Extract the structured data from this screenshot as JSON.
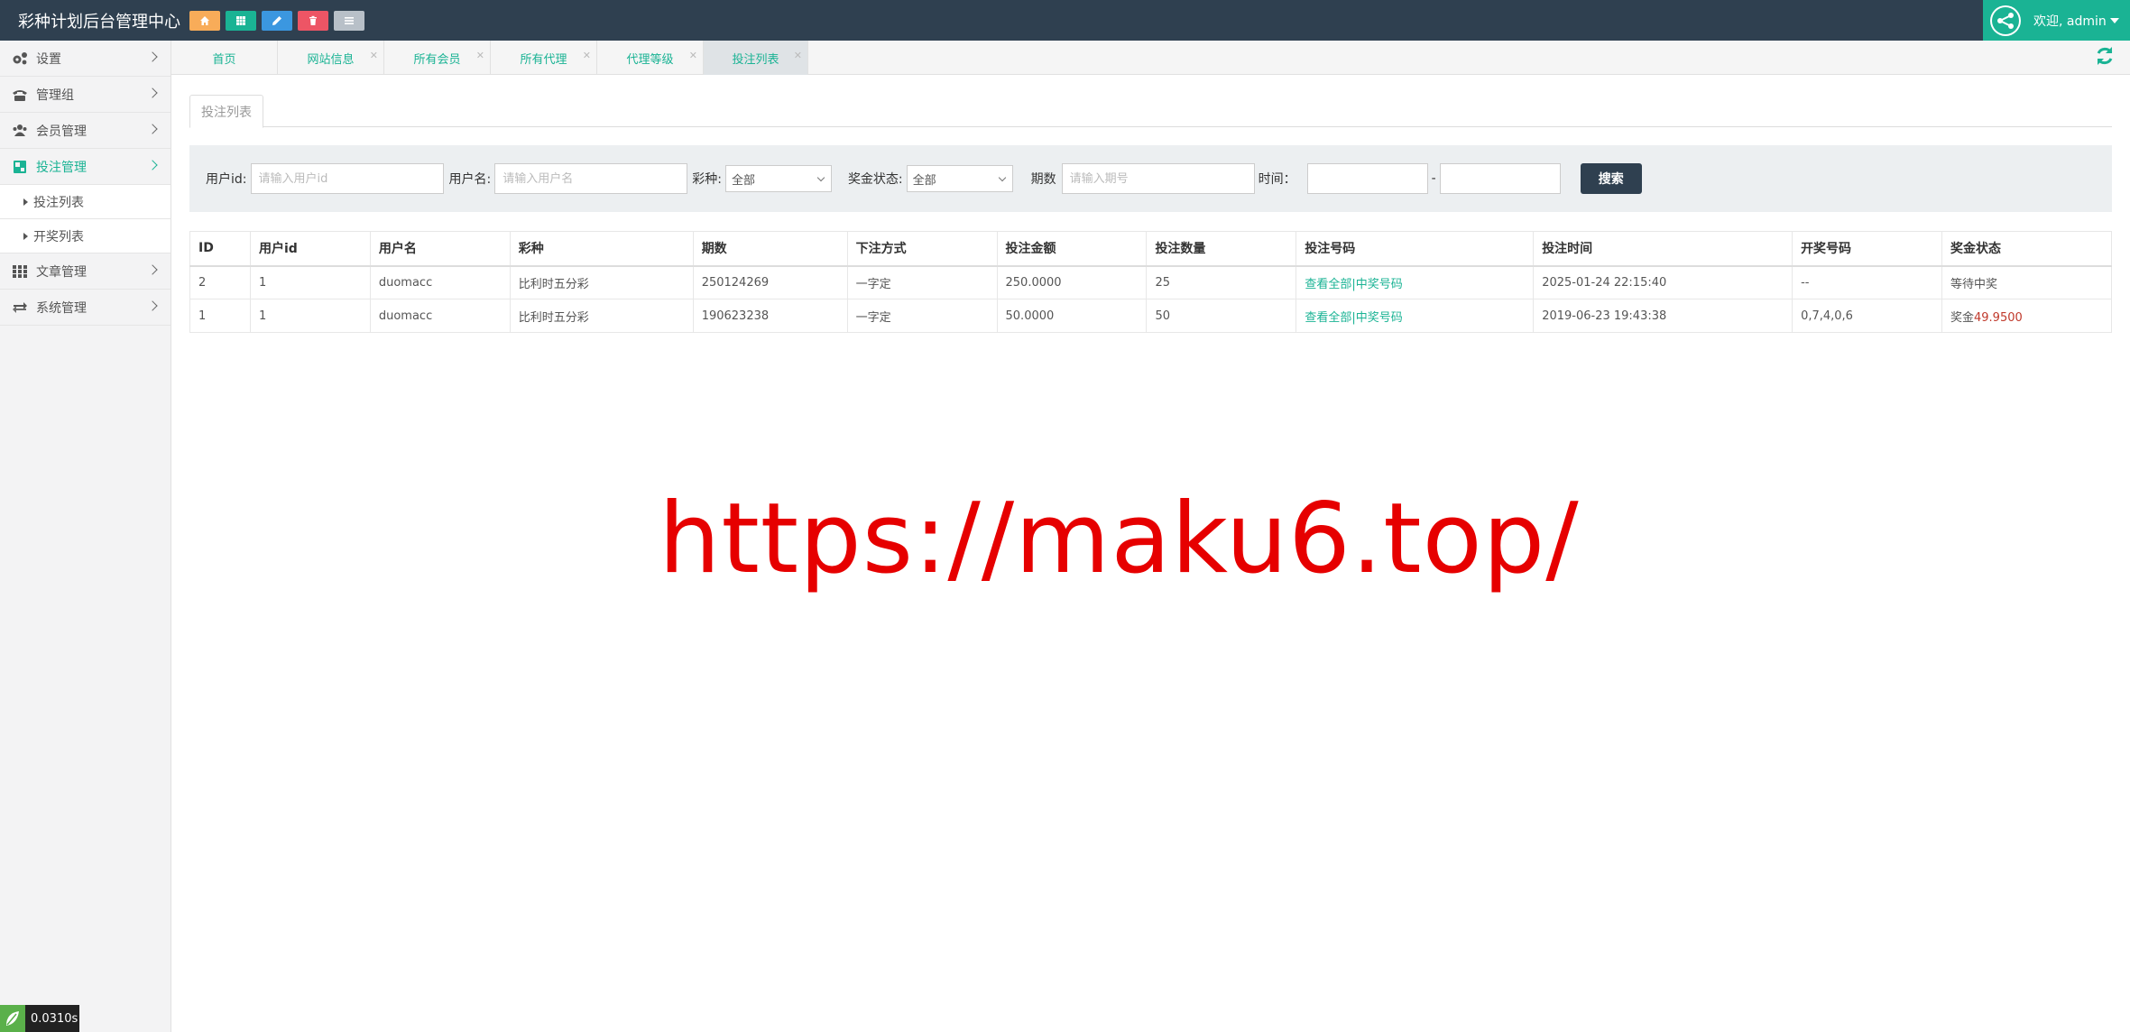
{
  "app": {
    "title": "彩种计划后台管理中心"
  },
  "quick_buttons": [
    {
      "icon": "home-icon",
      "color": "#f8ac59"
    },
    {
      "icon": "grid-icon",
      "color": "#1ab394"
    },
    {
      "icon": "pencil-icon",
      "color": "#3b97e0"
    },
    {
      "icon": "trash-icon",
      "color": "#ed5565"
    },
    {
      "icon": "list-icon",
      "color": "#b8c0c8"
    }
  ],
  "user": {
    "welcome": "欢迎, admin"
  },
  "sidebar": {
    "items": [
      {
        "label": "设置",
        "icon": "gears-icon"
      },
      {
        "label": "管理组",
        "icon": "phone-icon"
      },
      {
        "label": "会员管理",
        "icon": "users-icon"
      },
      {
        "label": "投注管理",
        "icon": "dashboard-icon",
        "active": true
      },
      {
        "label": "文章管理",
        "icon": "apps-icon"
      },
      {
        "label": "系统管理",
        "icon": "exchange-icon"
      }
    ],
    "sub_items": [
      {
        "label": "投注列表"
      },
      {
        "label": "开奖列表"
      }
    ]
  },
  "tabs": [
    {
      "label": "首页"
    },
    {
      "label": "网站信息"
    },
    {
      "label": "所有会员"
    },
    {
      "label": "所有代理"
    },
    {
      "label": "代理等级"
    },
    {
      "label": "投注列表",
      "active": true
    }
  ],
  "page_tab": "投注列表",
  "filter": {
    "user_id_label": "用户id:",
    "user_id_placeholder": "请输入用户id",
    "username_label": "用户名:",
    "username_placeholder": "请输入用户名",
    "lottery_label": "彩种:",
    "lottery_value": "全部",
    "prize_label": "奖金状态:",
    "prize_value": "全部",
    "issue_label": "期数",
    "issue_placeholder": "请输入期号",
    "time_label": "时间：",
    "time_sep": "-",
    "search_label": "搜索"
  },
  "table": {
    "headers": [
      "ID",
      "用户id",
      "用户名",
      "彩种",
      "期数",
      "下注方式",
      "投注金额",
      "投注数量",
      "投注号码",
      "投注时间",
      "开奖号码",
      "奖金状态"
    ],
    "rows": [
      {
        "id": "2",
        "user_id": "1",
        "username": "duomacc",
        "lottery": "比利时五分彩",
        "issue": "250124269",
        "method": "一字定",
        "amount": "250.0000",
        "count": "25",
        "numbers": "查看全部|中奖号码",
        "time": "2025-01-24 22:15:40",
        "draw": "--",
        "status_prefix": "等待中奖",
        "status_value": ""
      },
      {
        "id": "1",
        "user_id": "1",
        "username": "duomacc",
        "lottery": "比利时五分彩",
        "issue": "190623238",
        "method": "一字定",
        "amount": "50.0000",
        "count": "50",
        "numbers": "查看全部|中奖号码",
        "time": "2019-06-23 19:43:38",
        "draw": "0,7,4,0,6",
        "status_prefix": "奖金",
        "status_value": "49.9500"
      }
    ]
  },
  "timer": "0.0310s",
  "watermark": "https://maku6.top/",
  "colors": {
    "topbar": "#2f4050",
    "accent": "#1ab394",
    "watermark": "#e60000"
  }
}
